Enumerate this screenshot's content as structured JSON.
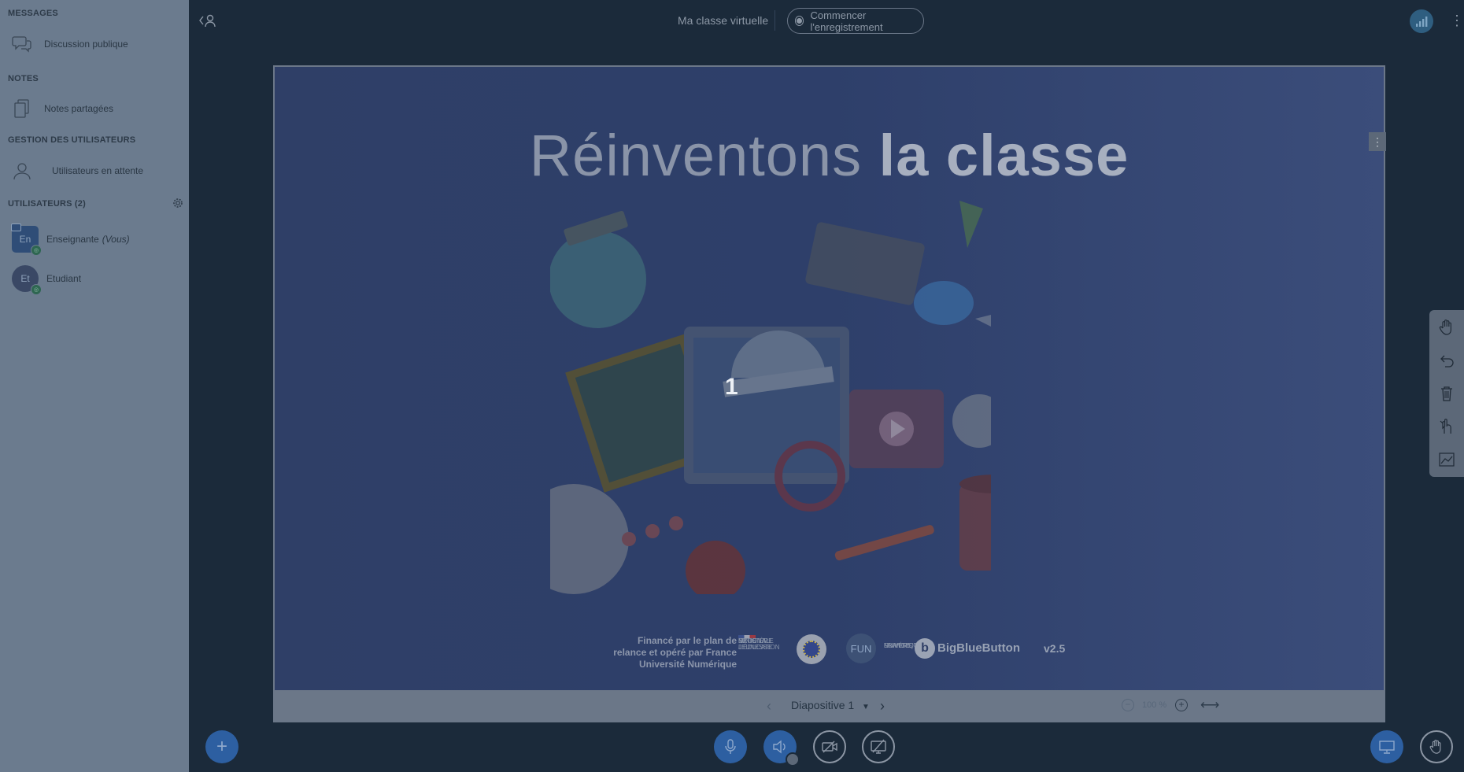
{
  "sidebar": {
    "messages_title": "MESSAGES",
    "public_chat": "Discussion publique",
    "notes_title": "NOTES",
    "shared_notes": "Notes partagées",
    "user_mgmt_title": "GESTION DES UTILISATEURS",
    "waiting_users": "Utilisateurs en attente",
    "users_title": "UTILISATEURS (2)",
    "users": [
      {
        "initials": "En",
        "name": "Enseignante",
        "suffix": "(Vous)"
      },
      {
        "initials": "Et",
        "name": "Etudiant",
        "suffix": ""
      }
    ]
  },
  "header": {
    "title": "Ma classe virtuelle",
    "record_label": "Commencer l'enregistrement"
  },
  "slide": {
    "title_light": "Réinventons ",
    "title_bold": "la classe",
    "number": "1",
    "funding": [
      "Financé par le plan de",
      "relance et opéré par France",
      "Université Numérique"
    ],
    "ministry": [
      "MINISTÈRE",
      "DE L'ÉDUCATION",
      "NATIONALE",
      "ET DE LA JEUNESSE"
    ],
    "fun_logo": "FUN",
    "fun_text": [
      "FRANCE",
      "UNIVERSITÉ",
      "NUMÉRIQUE"
    ],
    "bbb_name": "BigBlueButton",
    "bbb_version": "v2.5"
  },
  "slide_nav": {
    "current": "Diapositive 1",
    "zoom": "100 %"
  },
  "colors": {
    "accent": "#2d5fa1",
    "sidebar": "#6b7b8e",
    "background": "#1b2a3a"
  }
}
